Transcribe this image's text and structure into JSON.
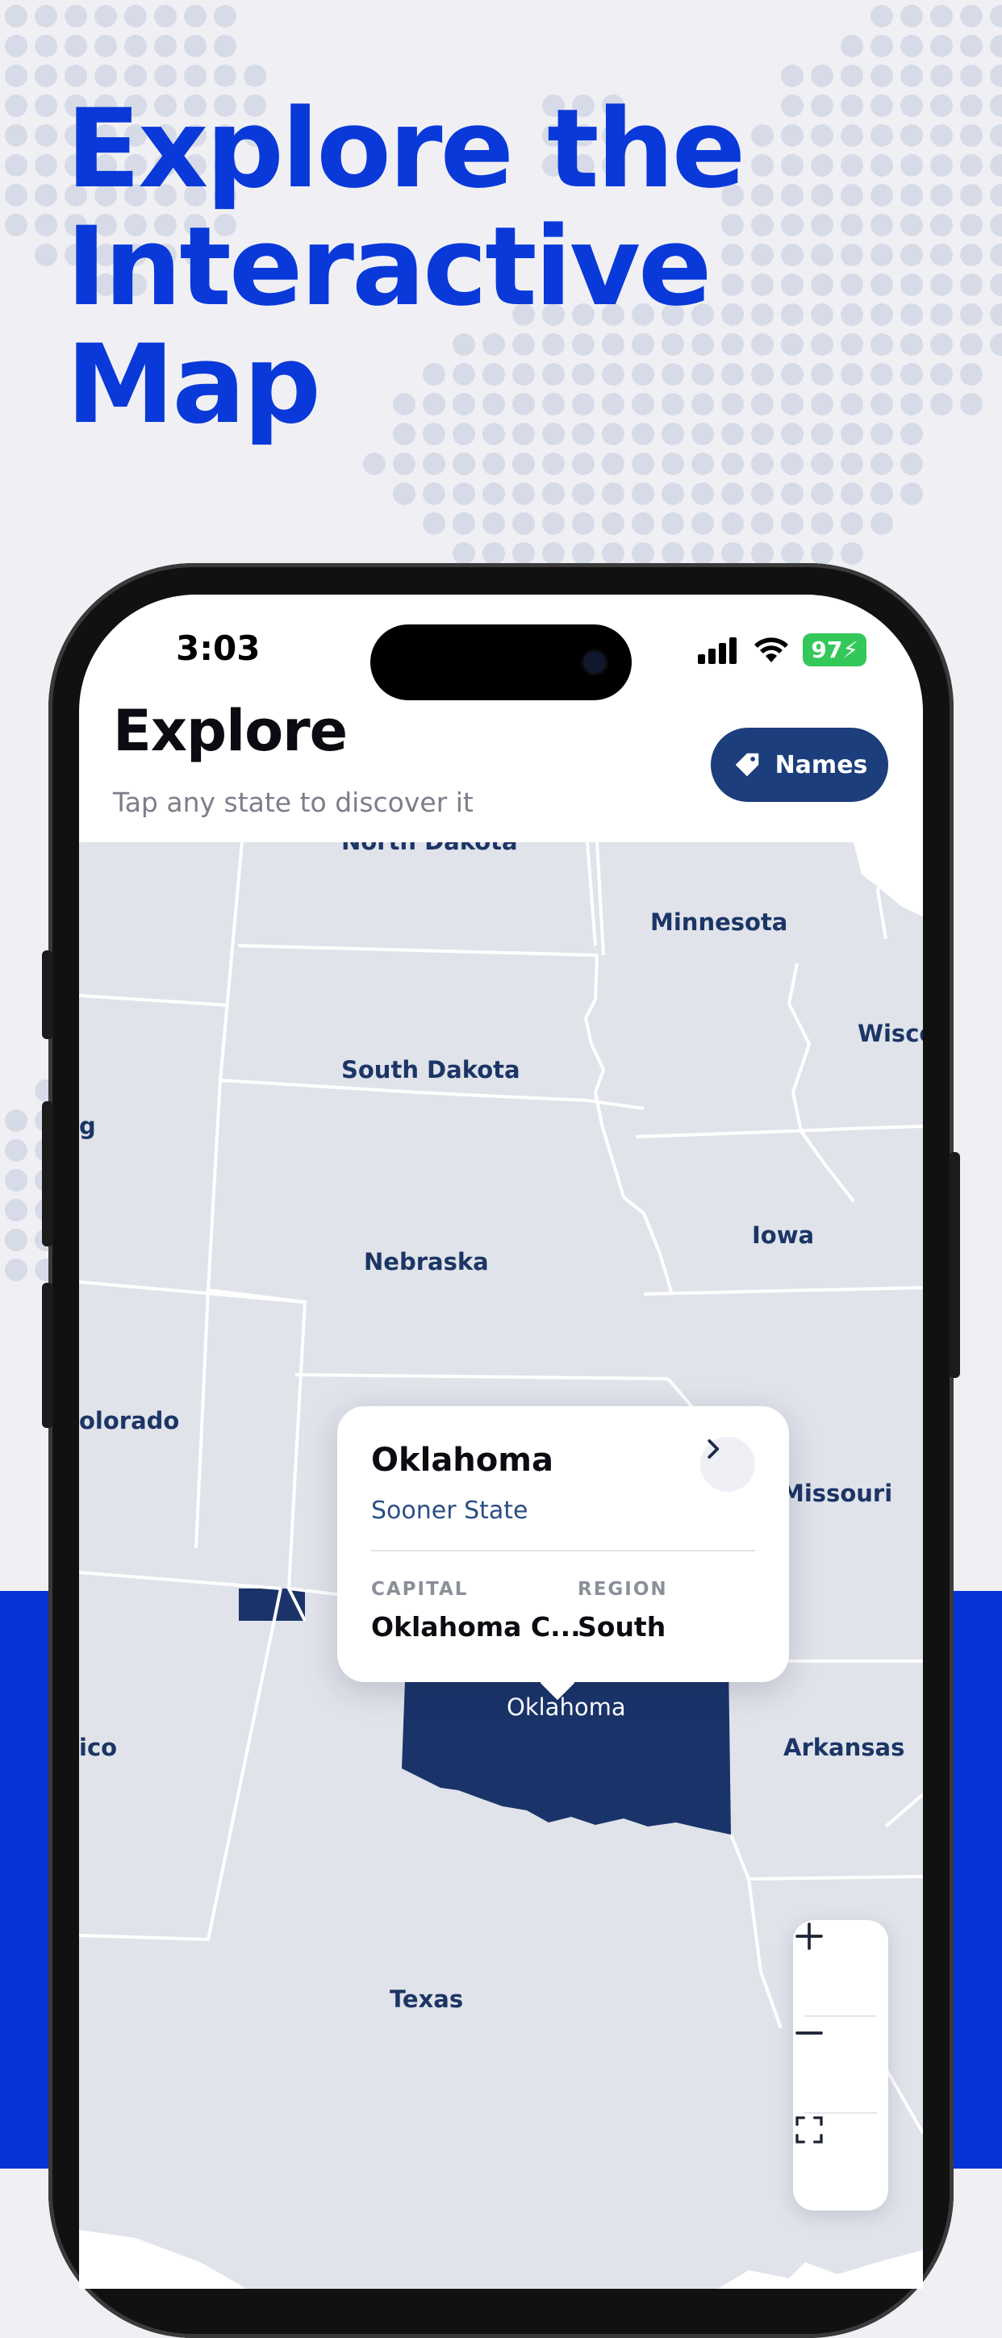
{
  "promo": {
    "headline": [
      "Explore the",
      "Interactive",
      "Map"
    ],
    "accent_color": "#0533d6"
  },
  "status_bar": {
    "time": "3:03",
    "battery": "97"
  },
  "app": {
    "title": "Explore",
    "subtitle": "Tap any state to discover it",
    "names_button": "Names"
  },
  "map": {
    "states": {
      "north_dakota": "North Dakota",
      "minnesota": "Minnesota",
      "wisconsin": "Wisco",
      "south_dakota": "South Dakota",
      "wyoming": "g",
      "iowa": "Iowa",
      "nebraska": "Nebraska",
      "colorado": "olorado",
      "missouri": "Missouri",
      "new_mexico": "ico",
      "oklahoma": "Oklahoma",
      "arkansas": "Arkansas",
      "texas": "Texas"
    },
    "selected_color": "#1a346a"
  },
  "info_card": {
    "name": "Oklahoma",
    "nickname": "Sooner State",
    "capital_label": "CAPITAL",
    "capital_value": "Oklahoma C...",
    "region_label": "REGION",
    "region_value": "South"
  },
  "zoom": {
    "zoom_in_icon": "plus-icon",
    "zoom_out_icon": "minus-icon",
    "fit_icon": "fit-frame-icon"
  }
}
